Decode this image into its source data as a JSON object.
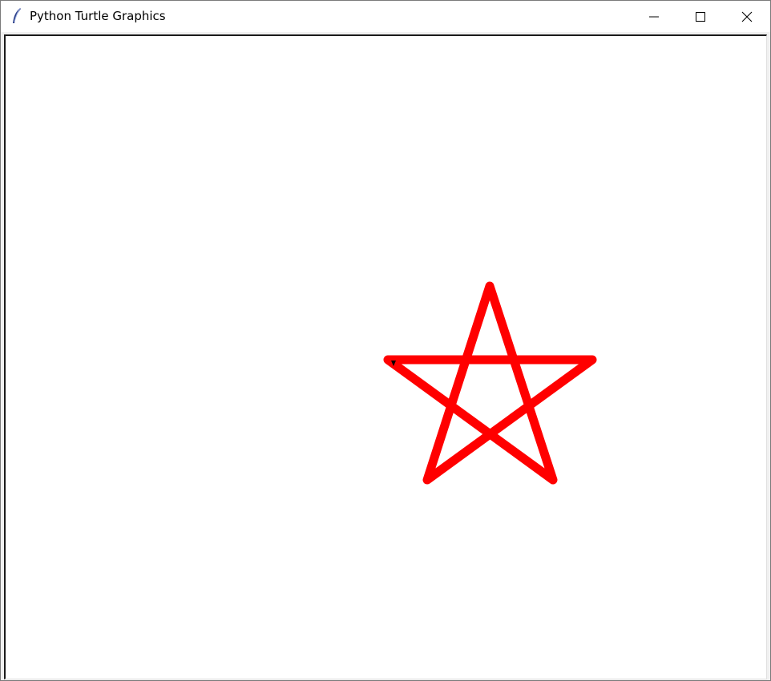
{
  "window": {
    "title": "Python Turtle Graphics"
  },
  "icons": {
    "app": "feather-icon",
    "minimize": "minimize-icon",
    "maximize": "maximize-icon",
    "close": "close-icon"
  },
  "drawing": {
    "shape": "five-pointed star",
    "pen_color": "#ff0000",
    "background": "#ffffff",
    "turtle_color": "#000000"
  }
}
